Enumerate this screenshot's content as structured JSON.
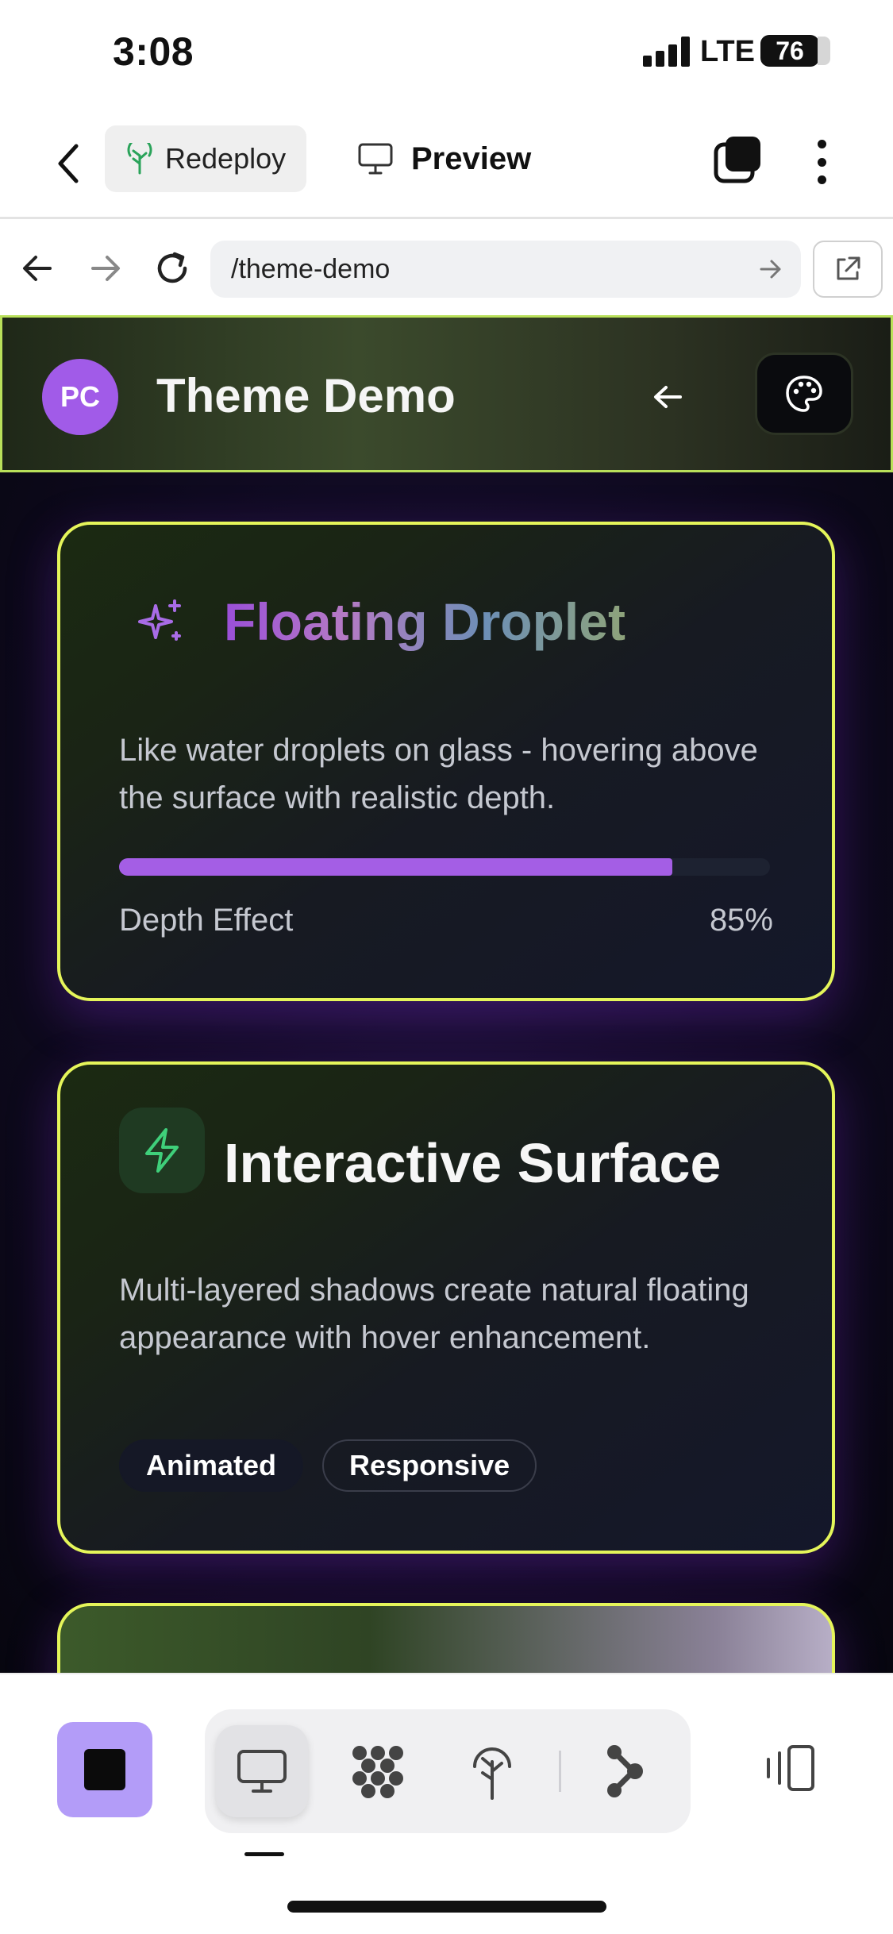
{
  "status_bar": {
    "time": "3:08",
    "network": "LTE",
    "battery": "76"
  },
  "app_header": {
    "redeploy_label": "Redeploy",
    "preview_label": "Preview"
  },
  "browser": {
    "url": "/theme-demo"
  },
  "demo": {
    "avatar_initials": "PC",
    "title": "Theme Demo",
    "cards": [
      {
        "icon": "sparkle-icon",
        "title": "Floating Droplet",
        "description": "Like water droplets on glass - hovering above the surface with realistic depth.",
        "progress_label": "Depth Effect",
        "progress_value_text": "85%",
        "progress_fraction": 0.85
      },
      {
        "icon": "lightning-icon",
        "title": "Interactive Surface",
        "description": "Multi-layered shadows create natural floating appearance with hover enhancement.",
        "tags": [
          "Animated",
          "Responsive"
        ]
      }
    ]
  },
  "colors": {
    "accent_purple": "#a45ee5",
    "card_border": "#e5f55a",
    "header_border": "#b9e05a",
    "stop_button": "#b39cf8"
  },
  "bottom_bar": {
    "tools": [
      "monitor-icon",
      "apps-grid-icon",
      "deploy-tree-icon",
      "branch-icon"
    ],
    "active_tool": "monitor-icon"
  }
}
